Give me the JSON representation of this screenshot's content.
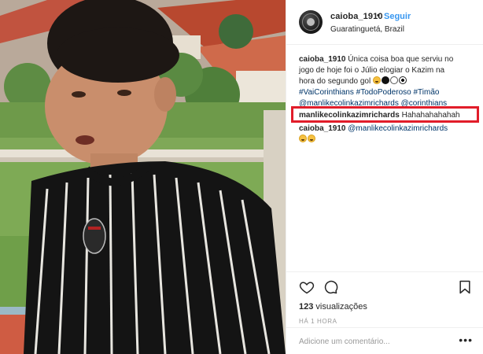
{
  "post": {
    "username": "caioba_1910",
    "dot": "•",
    "follow_label": "Seguir",
    "location": "Guaratinguetá, Brazil"
  },
  "comments": [
    {
      "user": "caioba_1910",
      "lines": [
        "Única coisa boa que serviu no",
        "jogo de hoje foi o Júlio elogiar o Kazim na",
        "hora do segundo gol"
      ],
      "hashtags_line": "#VaiCorinthians #TodoPoderoso #Timão",
      "mentions_line": "@manlikecolinkazimrichards @corinthians"
    },
    {
      "user": "manlikecolinkazimrichards",
      "text": "Hahahahahahah"
    },
    {
      "user": "caioba_1910",
      "text": "@manlikecolinkazimrichards"
    }
  ],
  "actions": {
    "views_count": "123",
    "views_label": "visualizações",
    "time_ago": "HÁ 1 HORA",
    "add_comment_placeholder": "Adicione um comentário...",
    "more": "•••"
  },
  "colors": {
    "accent": "#3897f0",
    "highlight": "#e11d2a",
    "tag": "#003569"
  },
  "icons": [
    "heart-icon",
    "comment-icon",
    "bookmark-icon",
    "more-options-icon"
  ]
}
